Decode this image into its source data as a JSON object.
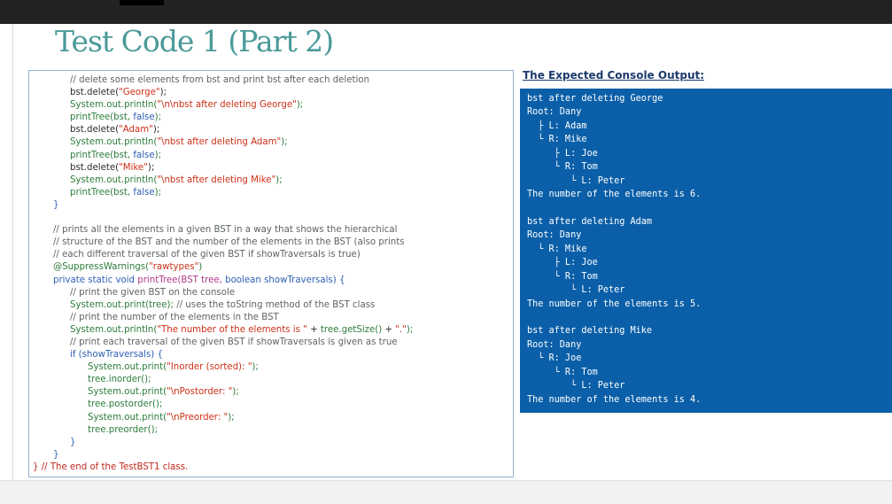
{
  "slide": {
    "title": "Test Code 1 (Part 2)"
  },
  "code_lines": [
    {
      "indent": 2,
      "parts": [
        {
          "k": "comment",
          "t": "// delete some elements from bst and print bst after each deletion"
        }
      ]
    },
    {
      "indent": 2,
      "parts": [
        {
          "k": "code",
          "t": "bst.delete("
        },
        {
          "k": "string",
          "t": "\"George\""
        },
        {
          "k": "code",
          "t": ");"
        }
      ]
    },
    {
      "indent": 2,
      "parts": [
        {
          "k": "method",
          "t": "System.out.println("
        },
        {
          "k": "string",
          "t": "\"\\n\\nbst after deleting George\""
        },
        {
          "k": "method",
          "t": ");"
        }
      ]
    },
    {
      "indent": 2,
      "parts": [
        {
          "k": "method",
          "t": "printTree(bst, "
        },
        {
          "k": "keyword",
          "t": "false"
        },
        {
          "k": "method",
          "t": ");"
        }
      ]
    },
    {
      "indent": 2,
      "parts": [
        {
          "k": "code",
          "t": "bst.delete("
        },
        {
          "k": "string",
          "t": "\"Adam\""
        },
        {
          "k": "code",
          "t": ");"
        }
      ]
    },
    {
      "indent": 2,
      "parts": [
        {
          "k": "method",
          "t": "System.out.println("
        },
        {
          "k": "string",
          "t": "\"\\nbst after deleting Adam\""
        },
        {
          "k": "method",
          "t": ");"
        }
      ]
    },
    {
      "indent": 2,
      "parts": [
        {
          "k": "method",
          "t": "printTree(bst, "
        },
        {
          "k": "keyword",
          "t": "false"
        },
        {
          "k": "method",
          "t": ");"
        }
      ]
    },
    {
      "indent": 2,
      "parts": [
        {
          "k": "code",
          "t": "bst.delete("
        },
        {
          "k": "string",
          "t": "\"Mike\""
        },
        {
          "k": "code",
          "t": ");"
        }
      ]
    },
    {
      "indent": 2,
      "parts": [
        {
          "k": "method",
          "t": "System.out.println("
        },
        {
          "k": "string",
          "t": "\"\\nbst after deleting Mike\""
        },
        {
          "k": "method",
          "t": ");"
        }
      ]
    },
    {
      "indent": 2,
      "parts": [
        {
          "k": "method",
          "t": "printTree(bst, "
        },
        {
          "k": "keyword",
          "t": "false"
        },
        {
          "k": "method",
          "t": ");"
        }
      ]
    },
    {
      "indent": 1,
      "parts": [
        {
          "k": "keyword",
          "t": "}"
        }
      ]
    },
    {
      "indent": 0,
      "parts": []
    },
    {
      "indent": 1,
      "parts": [
        {
          "k": "comment",
          "t": "// prints all the elements in a given BST in a way that shows the hierarchical"
        }
      ]
    },
    {
      "indent": 1,
      "parts": [
        {
          "k": "comment",
          "t": "// structure of the BST and the number of the elements in the BST (also prints"
        }
      ]
    },
    {
      "indent": 1,
      "parts": [
        {
          "k": "comment",
          "t": "// each different traversal of the given BST if showTraversals is true)"
        }
      ]
    },
    {
      "indent": 1,
      "parts": [
        {
          "k": "anno",
          "t": "@SuppressWarnings("
        },
        {
          "k": "string",
          "t": "\"rawtypes\""
        },
        {
          "k": "anno",
          "t": ")"
        }
      ]
    },
    {
      "indent": 1,
      "parts": [
        {
          "k": "keyword",
          "t": "private static void "
        },
        {
          "k": "type",
          "t": "printTree(BST tree, "
        },
        {
          "k": "keyword",
          "t": "boolean showTraversals) {"
        }
      ]
    },
    {
      "indent": 2,
      "parts": [
        {
          "k": "comment",
          "t": "// print the given BST on the console"
        }
      ]
    },
    {
      "indent": 2,
      "parts": [
        {
          "k": "method",
          "t": "System.out.print(tree); "
        },
        {
          "k": "comment",
          "t": "// uses the toString method of the BST class"
        }
      ]
    },
    {
      "indent": 2,
      "parts": [
        {
          "k": "comment",
          "t": "// print the number of the elements in the BST"
        }
      ]
    },
    {
      "indent": 2,
      "parts": [
        {
          "k": "method",
          "t": "System.out.println("
        },
        {
          "k": "string",
          "t": "\"The number of the elements is \""
        },
        {
          "k": "code",
          "t": " + "
        },
        {
          "k": "method",
          "t": "tree.getSize()"
        },
        {
          "k": "code",
          "t": " + "
        },
        {
          "k": "string",
          "t": "\".\""
        },
        {
          "k": "method",
          "t": ");"
        }
      ]
    },
    {
      "indent": 2,
      "parts": [
        {
          "k": "comment",
          "t": "// print each traversal of the given BST if showTraversals is given as true"
        }
      ]
    },
    {
      "indent": 2,
      "parts": [
        {
          "k": "keyword",
          "t": "if (showTraversals) {"
        }
      ]
    },
    {
      "indent": 3,
      "parts": [
        {
          "k": "method",
          "t": "System.out.print("
        },
        {
          "k": "string",
          "t": "\"Inorder (sorted): \""
        },
        {
          "k": "method",
          "t": ");"
        }
      ]
    },
    {
      "indent": 3,
      "parts": [
        {
          "k": "method",
          "t": "tree.inorder();"
        }
      ]
    },
    {
      "indent": 3,
      "parts": [
        {
          "k": "method",
          "t": "System.out.print("
        },
        {
          "k": "string",
          "t": "\"\\nPostorder: \""
        },
        {
          "k": "method",
          "t": ");"
        }
      ]
    },
    {
      "indent": 3,
      "parts": [
        {
          "k": "method",
          "t": "tree.postorder();"
        }
      ]
    },
    {
      "indent": 3,
      "parts": [
        {
          "k": "method",
          "t": "System.out.print("
        },
        {
          "k": "string",
          "t": "\"\\nPreorder: \""
        },
        {
          "k": "method",
          "t": ");"
        }
      ]
    },
    {
      "indent": 3,
      "parts": [
        {
          "k": "method",
          "t": "tree.preorder();"
        }
      ]
    },
    {
      "indent": 2,
      "parts": [
        {
          "k": "keyword",
          "t": "}"
        }
      ]
    },
    {
      "indent": 1,
      "parts": [
        {
          "k": "keyword",
          "t": "}"
        }
      ]
    },
    {
      "indent": 0,
      "parts": [
        {
          "k": "closing",
          "t": "} // The end of the TestBST1 class."
        }
      ]
    }
  ],
  "output": {
    "heading": "The Expected Console Output:",
    "lines": [
      "bst after deleting George",
      "Root: Dany",
      "  ├ L: Adam",
      "  └ R: Mike",
      "     ├ L: Joe",
      "     └ R: Tom",
      "        └ L: Peter",
      "The number of the elements is 6.",
      "",
      "bst after deleting Adam",
      "Root: Dany",
      "  └ R: Mike",
      "     ├ L: Joe",
      "     └ R: Tom",
      "        └ L: Peter",
      "The number of the elements is 5.",
      "",
      "bst after deleting Mike",
      "Root: Dany",
      "  └ R: Joe",
      "     └ R: Tom",
      "        └ L: Peter",
      "The number of the elements is 4."
    ]
  },
  "colors": {
    "title": "#4a9a99",
    "console_background": "#0b5fa8",
    "top_bar": "#222222",
    "code_border": "#8fb4d3"
  }
}
